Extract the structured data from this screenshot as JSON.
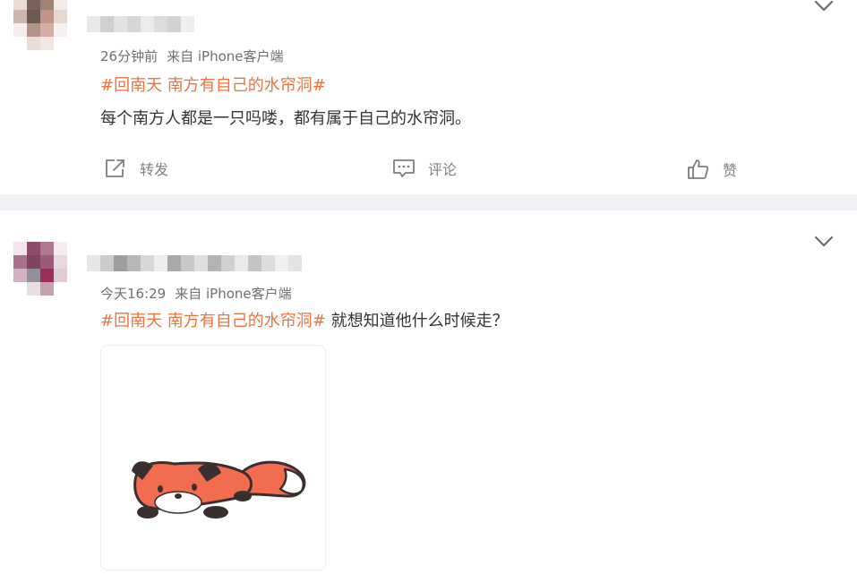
{
  "feed": {
    "posts": [
      {
        "timestamp": "26分钟前",
        "source": "来自 iPhone客户端",
        "topic": "#回南天 南方有自己的水帘洞#",
        "content": "每个南方人都是一只吗喽，都有属于自己的水帘洞。",
        "actions": {
          "repost_label": "转发",
          "comment_label": "评论",
          "like_label": "赞"
        }
      },
      {
        "timestamp": "今天16:29",
        "source": "来自 iPhone客户端",
        "topic": "#回南天 南方有自己的水帘洞#",
        "content": "就想知道他什么时候走？",
        "image": "sleeping-fox-sticker"
      }
    ]
  },
  "icons": {
    "more_menu": "chevron-down-icon",
    "repost": "repost-icon",
    "comment": "comment-icon",
    "like": "thumbs-up-icon"
  },
  "colors": {
    "topic_link": "#eb7340",
    "meta_text": "#6f6f6f",
    "body_text": "#333333",
    "divider": "#f1f2f5",
    "fox_orange": "#f26c4f",
    "fox_dark": "#3a2f2f"
  }
}
